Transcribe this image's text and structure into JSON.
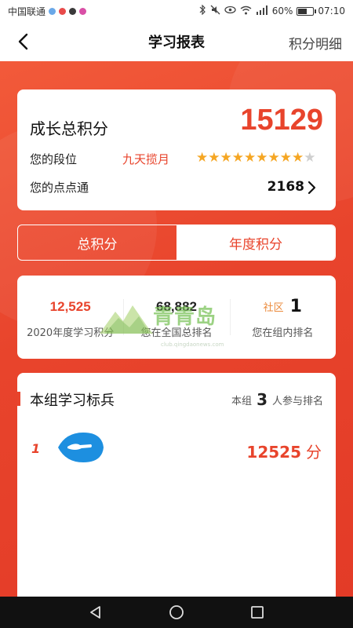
{
  "status_bar": {
    "carrier": "中国联通",
    "battery": "60%",
    "time": "07:10",
    "battery_level": 0.6,
    "icons": [
      "bluetooth-icon",
      "mute-icon",
      "eye-icon",
      "wifi-icon",
      "signal-icon",
      "battery-icon"
    ]
  },
  "header": {
    "title": "学习报表",
    "right_link": "积分明细"
  },
  "score_card": {
    "total_label": "成长总积分",
    "total_value": "15129",
    "rank_label": "您的段位",
    "rank_name": "九天揽月",
    "stars_total": 10,
    "stars_filled": 9,
    "points_label": "您的点点通",
    "points_value": "2168"
  },
  "tabs": [
    {
      "label": "总积分",
      "active": true
    },
    {
      "label": "年度积分",
      "active": false
    }
  ],
  "stats": [
    {
      "value": "12,525",
      "label": "2020年度学习积分",
      "color": "#e8442c"
    },
    {
      "value": "68,882",
      "label": "您在全国总排名",
      "color": "#222222"
    },
    {
      "tag": "社区",
      "value": "1",
      "label": "您在组内排名"
    }
  ],
  "group": {
    "title": "本组学习标兵",
    "count_prefix": "本组",
    "count": "3",
    "count_suffix": "人参与排名",
    "members": [
      {
        "rank": "1",
        "score": "12525",
        "unit": "分"
      }
    ]
  },
  "watermark": {
    "text": "青青岛",
    "url": "club.qingdaonews.com"
  },
  "colors": {
    "accent": "#e8442c",
    "star": "#f5a623",
    "star_off": "#cfcfcf",
    "watermark": "#7cc35b",
    "avatar": "#1d8fe0"
  }
}
